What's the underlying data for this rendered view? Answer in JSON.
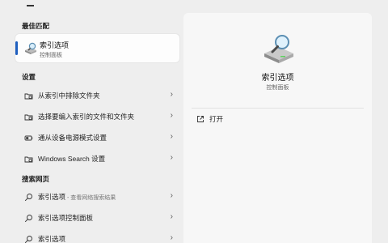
{
  "best_match": {
    "heading": "最佳匹配",
    "title": "索引选项",
    "subtitle": "控制面板"
  },
  "settings": {
    "heading": "设置",
    "items": [
      {
        "label": "从索引中排除文件夹",
        "icon": "folder-index-icon"
      },
      {
        "label": "选择要编入索引的文件和文件夹",
        "icon": "folder-index-icon"
      },
      {
        "label": "通从设备电源模式设置",
        "icon": "power-icon"
      },
      {
        "label": "Windows Search 设置",
        "icon": "folder-index-icon"
      }
    ]
  },
  "web": {
    "heading": "搜索网页",
    "items": [
      {
        "label": "索引选项",
        "sub": " - 查看网络搜索结果",
        "icon": "search-icon"
      },
      {
        "label": "索引选项控制面板",
        "sub": "",
        "icon": "search-icon"
      },
      {
        "label": "索引选项",
        "sub": "",
        "icon": "search-icon"
      }
    ]
  },
  "detail": {
    "title": "索引选项",
    "subtitle": "控制面板",
    "open_label": "打开"
  },
  "colors": {
    "accent": "#1f5fbf"
  }
}
